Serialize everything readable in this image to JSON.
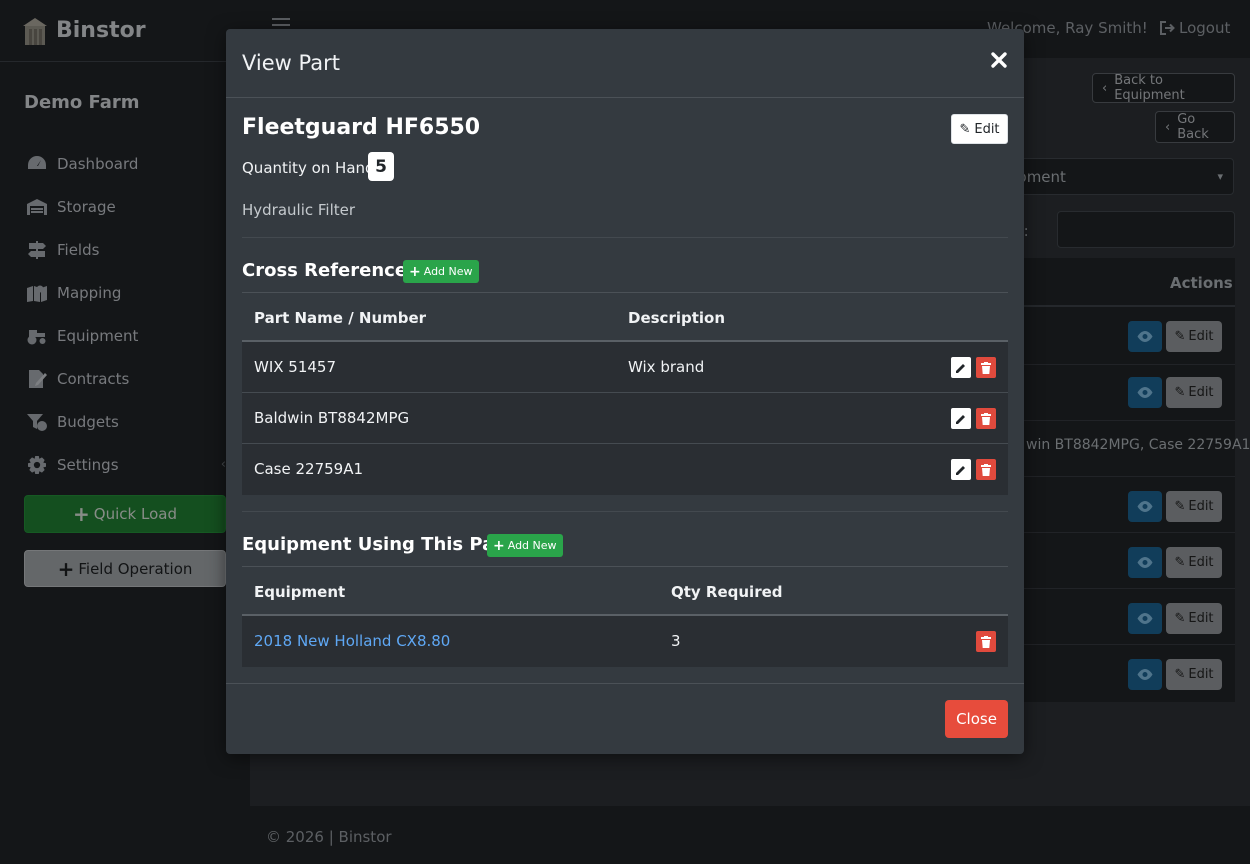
{
  "app": {
    "brand": "Binstor",
    "farm": "Demo Farm"
  },
  "sidebar": {
    "items": [
      {
        "label": "Dashboard",
        "icon": "dashboard-icon"
      },
      {
        "label": "Storage",
        "icon": "warehouse-icon"
      },
      {
        "label": "Fields",
        "icon": "signpost-icon"
      },
      {
        "label": "Mapping",
        "icon": "map-icon"
      },
      {
        "label": "Equipment",
        "icon": "tractor-icon"
      },
      {
        "label": "Contracts",
        "icon": "contract-icon"
      },
      {
        "label": "Budgets",
        "icon": "budget-icon"
      },
      {
        "label": "Settings",
        "icon": "gear-icon"
      }
    ],
    "quick_load": "Quick Load",
    "field_operation": "Field Operation"
  },
  "topbar": {
    "welcome": "Welcome, Ray Smith!",
    "logout": "Logout"
  },
  "background": {
    "back_to_equipment": "Back to Equipment",
    "go_back": "Go Back",
    "select_value": "ipment",
    "search_label": "rch:",
    "actions_header": "Actions",
    "row_text": "win BT8842MPG, Case 22759A1",
    "edit_label": "Edit"
  },
  "modal": {
    "title": "View Part",
    "part_name": "Fleetguard HF6550",
    "edit_label": "Edit",
    "qty_label": "Quantity on Hand:",
    "qty_value": "5",
    "description": "Hydraulic Filter",
    "cross_refs": {
      "title": "Cross References",
      "add_label": "Add New",
      "headers": [
        "Part Name / Number",
        "Description"
      ],
      "rows": [
        {
          "part": "WIX 51457",
          "description": "Wix brand"
        },
        {
          "part": "Baldwin BT8842MPG",
          "description": ""
        },
        {
          "part": "Case 22759A1",
          "description": ""
        }
      ]
    },
    "equipment": {
      "title": "Equipment Using This Part",
      "add_label": "Add New",
      "headers": [
        "Equipment",
        "Qty Required"
      ],
      "rows": [
        {
          "name": "2018 New Holland CX8.80",
          "qty": "3"
        }
      ]
    },
    "close_label": "Close"
  },
  "footer": {
    "text": "© 2026 | Binstor"
  },
  "colors": {
    "accent_green": "#2aa44a",
    "danger_red": "#e74c3c",
    "link_blue": "#5fa8f5",
    "modal_bg": "#343a40"
  }
}
